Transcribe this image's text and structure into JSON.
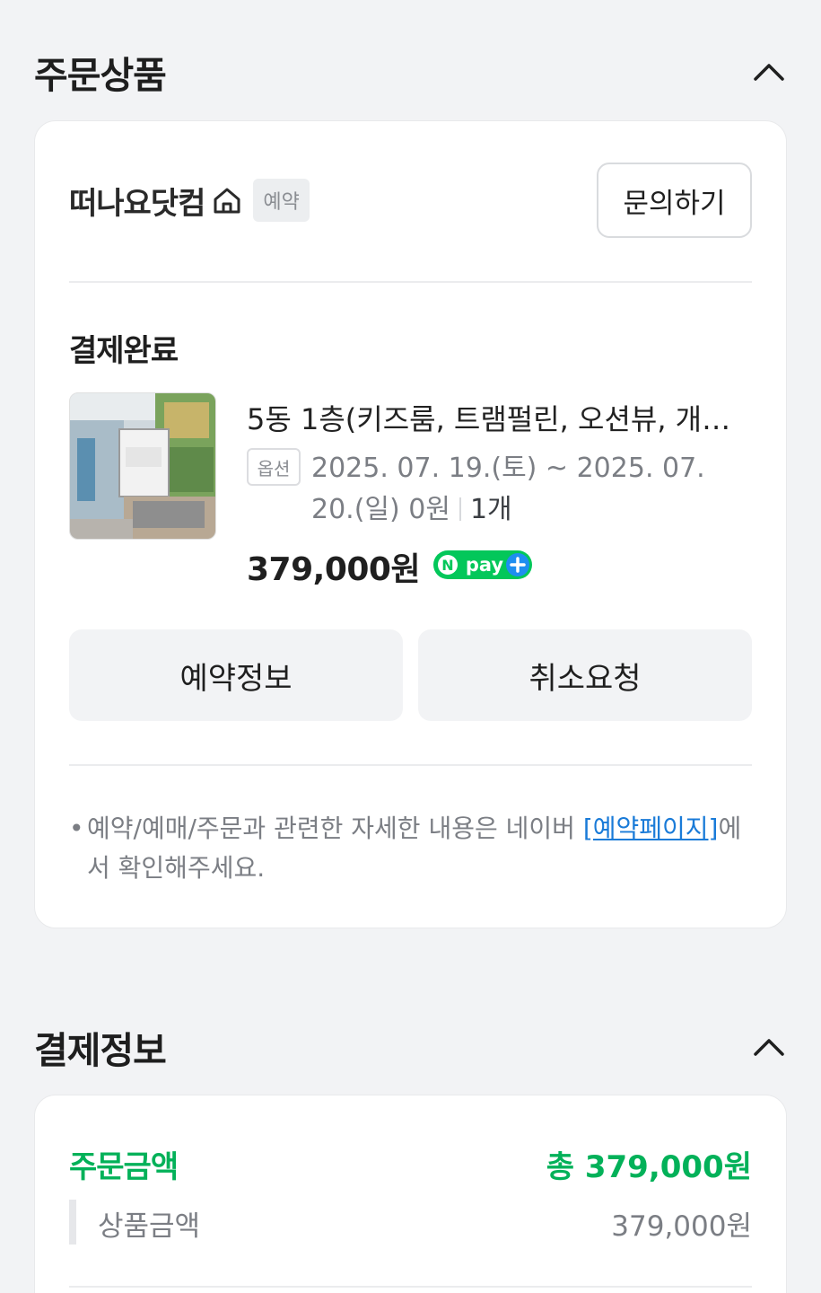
{
  "order_section": {
    "title": "주문상품",
    "seller": {
      "name": "떠나요닷컴",
      "tag": "예약",
      "inquiry_label": "문의하기"
    },
    "status": "결제완료",
    "product": {
      "name": "5동 1층(키즈룸, 트램펄린, 오션뷰, 개…",
      "option_tag": "옵션",
      "option_text": "2025. 07. 19.(토) ~ 2025. 07. 20.(일) 0원",
      "quantity": "1개",
      "price": "379,000원",
      "payment_badge": "Npay+"
    },
    "buttons": {
      "reservation_info": "예약정보",
      "cancel_request": "취소요청"
    },
    "notice": {
      "prefix": "예약/예매/주문과 관련한 자세한 내용은 네이버 ",
      "link": "[예약페이지]",
      "suffix": "에서 확인해주세요."
    }
  },
  "payment_section": {
    "title": "결제정보",
    "order_amount_label": "주문금액",
    "order_amount_value": "총 379,000원",
    "product_amount_label": "상품금액",
    "product_amount_value": "379,000원"
  },
  "colors": {
    "accent_green": "#03b159",
    "link_blue": "#1a7bd8",
    "background": "#f2f3f5"
  }
}
